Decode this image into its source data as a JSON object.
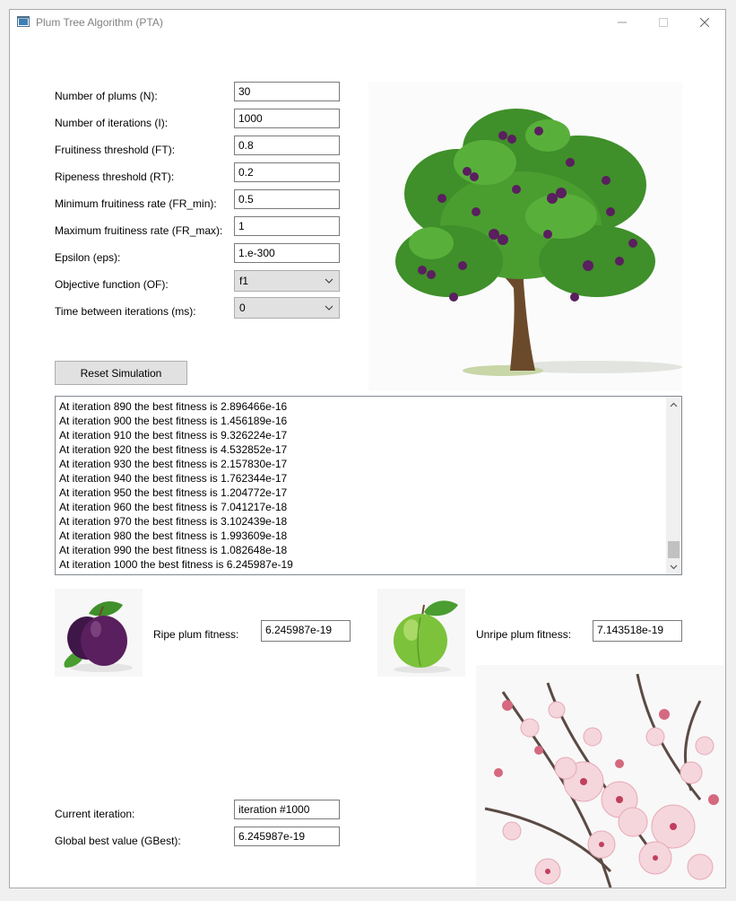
{
  "window": {
    "title": "Plum Tree Algorithm (PTA)"
  },
  "icons": {
    "app": "app-icon",
    "minimize": "minimize-icon",
    "maximize": "maximize-icon",
    "close": "close-icon",
    "dropdown": "chevron-down-icon"
  },
  "params": [
    {
      "label": "Number of plums (N):",
      "value": "30"
    },
    {
      "label": "Number of iterations (I):",
      "value": "1000"
    },
    {
      "label": "Fruitiness threshold (FT):",
      "value": "0.8"
    },
    {
      "label": "Ripeness threshold (RT):",
      "value": "0.2"
    },
    {
      "label": "Minimum fruitiness rate (FR_min):",
      "value": "0.5"
    },
    {
      "label": "Maximum fruitiness rate (FR_max):",
      "value": "1"
    },
    {
      "label": "Epsilon (eps):",
      "value": "1.e-300"
    }
  ],
  "objective": {
    "label": "Objective function (OF):",
    "value": "f1"
  },
  "time_between": {
    "label": "Time between iterations (ms):",
    "value": "0"
  },
  "reset_label": "Reset Simulation",
  "log": [
    "At iteration 890 the best fitness is 2.896466e-16",
    "At iteration 900 the best fitness is 1.456189e-16",
    "At iteration 910 the best fitness is 9.326224e-17",
    "At iteration 920 the best fitness is 4.532852e-17",
    "At iteration 930 the best fitness is 2.157830e-17",
    "At iteration 940 the best fitness is 1.762344e-17",
    "At iteration 950 the best fitness is 1.204772e-17",
    "At iteration 960 the best fitness is 7.041217e-18",
    "At iteration 970 the best fitness is 3.102439e-18",
    "At iteration 980 the best fitness is 1.993609e-18",
    "At iteration 990 the best fitness is 1.082648e-18",
    "At iteration 1000 the best fitness is 6.245987e-19"
  ],
  "ripe": {
    "label": "Ripe plum fitness:",
    "value": "6.245987e-19"
  },
  "unripe": {
    "label": "Unripe plum fitness:",
    "value": "7.143518e-19"
  },
  "current": {
    "label": "Current iteration:",
    "value": "iteration #1000"
  },
  "gbest": {
    "label": "Global best value (GBest):",
    "value": "6.245987e-19"
  },
  "colors": {
    "plum": "#5a1f5e",
    "leaf": "#3f8f2a",
    "unripe": "#7cc23a",
    "blossom": "#f4d6dc",
    "trunk": "#6b4a2b"
  }
}
